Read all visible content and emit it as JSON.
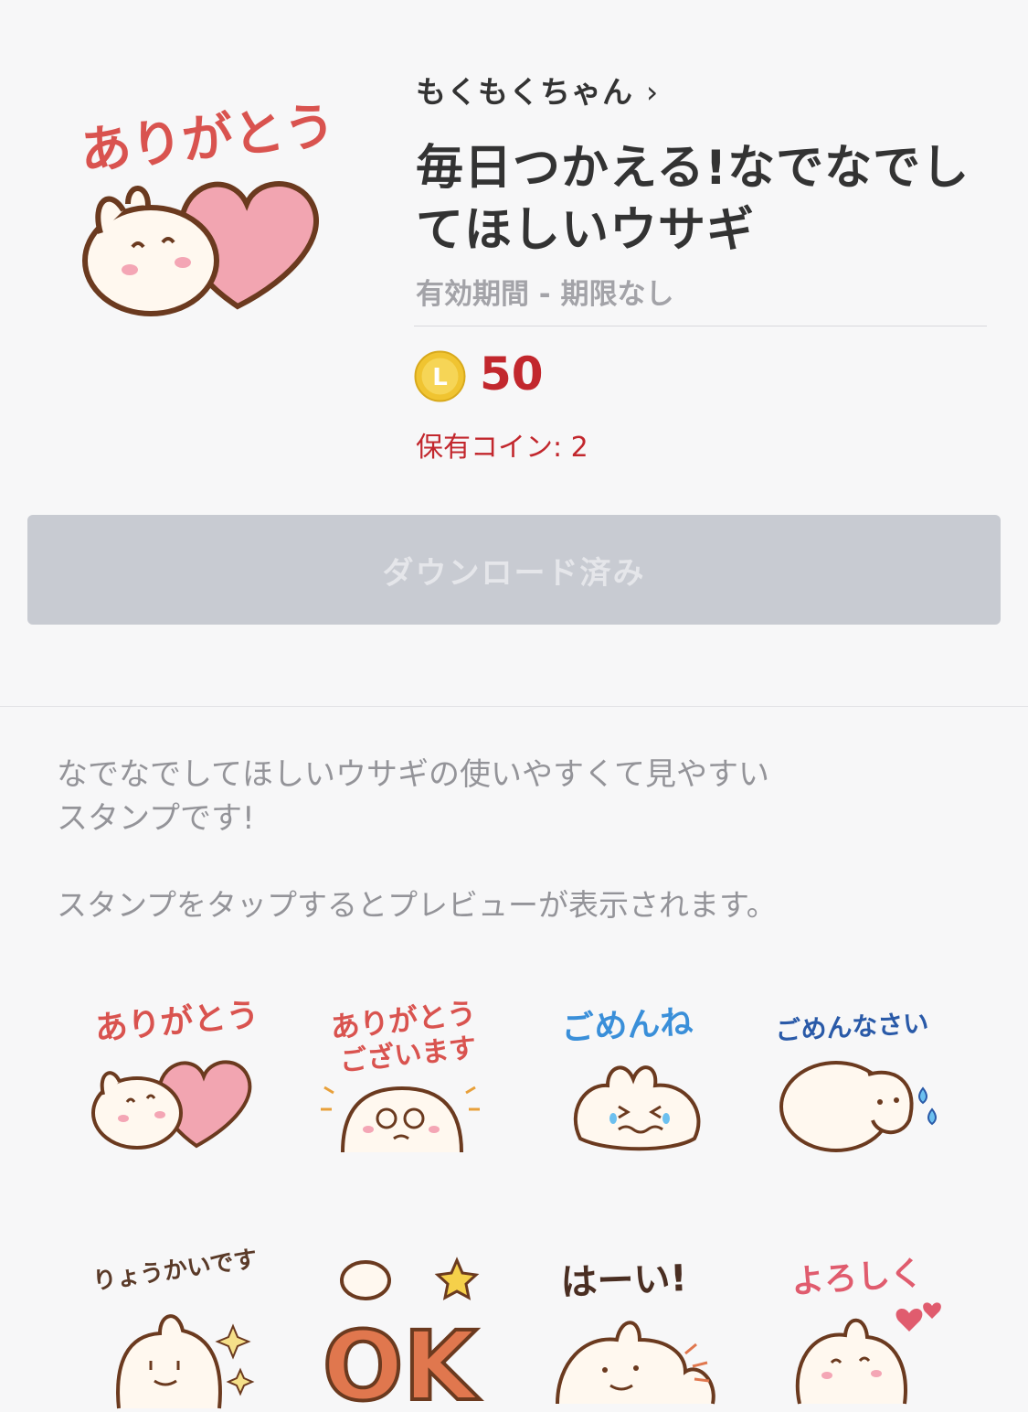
{
  "sticker_set": {
    "author": "もくもくちゃん",
    "author_chevron": "›",
    "title": "毎日つかえる!なでなでしてほしいウサギ",
    "validity": "有効期間 - 期限なし",
    "coin_letter": "L",
    "price": "50",
    "owned_coins": "保有コイン: 2",
    "download_button": "ダウンロード済み",
    "main_sticker_text": "ありがとう"
  },
  "description": {
    "line1": "なでなでしてほしいウサギの使いやすくて見やすい",
    "line2": "スタンプです!",
    "preview_hint": "スタンプをタップするとプレビューが表示されます。"
  },
  "stickers": [
    {
      "text": "ありがとう",
      "color": "#d9534f"
    },
    {
      "text": "ありがとう",
      "text2": "ございます",
      "color": "#d9534f"
    },
    {
      "text": "ごめんね",
      "color": "#3a8fd9"
    },
    {
      "text": "ごめんなさい",
      "color": "#2a5aa8"
    },
    {
      "text": "りょうかいです",
      "color": "#5a3a28"
    },
    {
      "text": "OK",
      "color": "#e0774e"
    },
    {
      "text": "はーい!",
      "color": "#4a2e22"
    },
    {
      "text": "よろしく",
      "color": "#e05c6e"
    }
  ],
  "colors": {
    "price_red": "#c2272d",
    "coin_gold": "#f0c431",
    "button_gray": "#c8cbd2",
    "outline_brown": "#6b3a1f",
    "heart_pink": "#f2a5b1"
  }
}
